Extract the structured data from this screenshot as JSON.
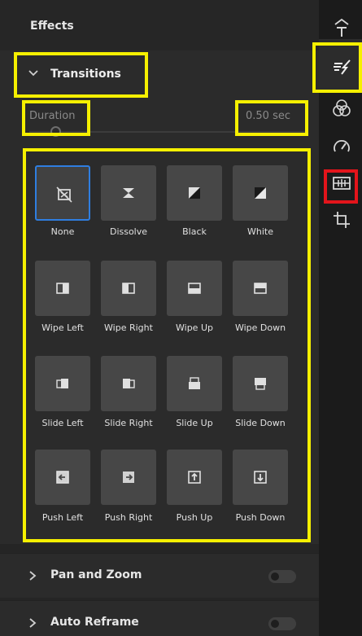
{
  "header": {
    "title": "Effects"
  },
  "transitions": {
    "label": "Transitions",
    "duration_label": "Duration",
    "duration_value": "0.50 sec",
    "items": [
      {
        "label": "None",
        "icon": "none-icon",
        "selected": true
      },
      {
        "label": "Dissolve",
        "icon": "dissolve-icon"
      },
      {
        "label": "Black",
        "icon": "black-icon"
      },
      {
        "label": "White",
        "icon": "white-icon"
      },
      {
        "label": "Wipe Left",
        "icon": "wipe-left-icon"
      },
      {
        "label": "Wipe Right",
        "icon": "wipe-right-icon"
      },
      {
        "label": "Wipe Up",
        "icon": "wipe-up-icon"
      },
      {
        "label": "Wipe Down",
        "icon": "wipe-down-icon"
      },
      {
        "label": "Slide Left",
        "icon": "slide-left-icon"
      },
      {
        "label": "Slide Right",
        "icon": "slide-right-icon"
      },
      {
        "label": "Slide Up",
        "icon": "slide-up-icon"
      },
      {
        "label": "Slide Down",
        "icon": "slide-down-icon"
      },
      {
        "label": "Push Left",
        "icon": "push-left-icon"
      },
      {
        "label": "Push Right",
        "icon": "push-right-icon"
      },
      {
        "label": "Push Up",
        "icon": "push-up-icon"
      },
      {
        "label": "Push Down",
        "icon": "push-down-icon"
      }
    ]
  },
  "sections": {
    "pan_zoom": {
      "label": "Pan and Zoom",
      "enabled": false
    },
    "auto_reframe": {
      "label": "Auto Reframe",
      "enabled": false
    }
  },
  "rail": {
    "icons": [
      "text-icon",
      "effects-icon",
      "color-icon",
      "speed-icon",
      "audio-icon",
      "crop-icon"
    ],
    "active": "effects-icon"
  },
  "colors": {
    "accent": "#2f7ee0",
    "highlight_yellow": "#f6f000",
    "highlight_red": "#e3141b"
  }
}
